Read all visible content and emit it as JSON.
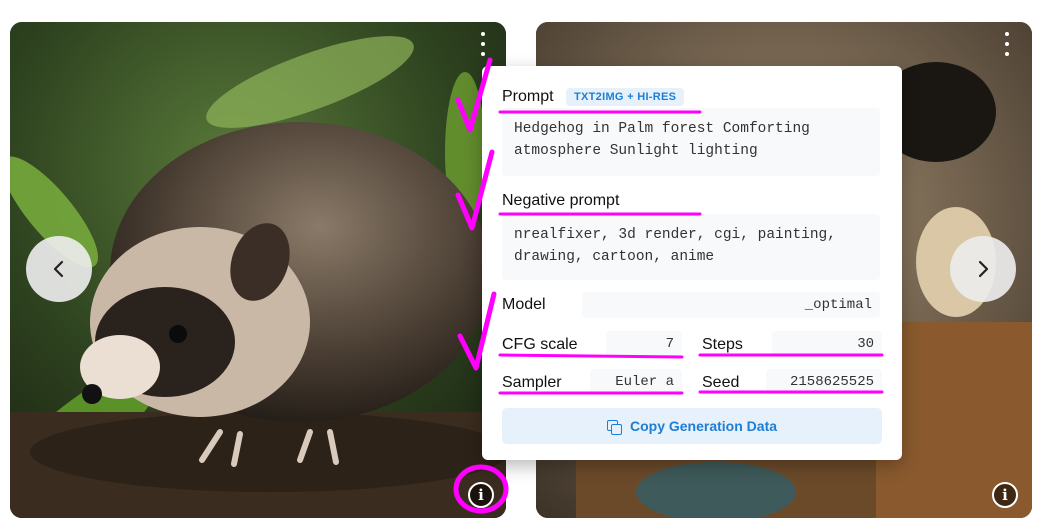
{
  "gallery": {
    "prev_icon": "chevron-left-icon",
    "next_icon": "chevron-right-icon",
    "more_icon": "more-vertical-icon",
    "info_icon": "info-icon",
    "info_glyph": "i"
  },
  "details": {
    "prompt_label": "Prompt",
    "mode_badge": "TXT2IMG + HI-RES",
    "prompt_text": "Hedgehog in Palm forest Comforting atmosphere Sunlight lighting",
    "negative_label": "Negative prompt",
    "negative_text": "nrealfixer, 3d render, cgi, painting, drawing, cartoon, anime",
    "model_label": "Model",
    "model_value": "_optimal",
    "cfg_label": "CFG scale",
    "cfg_value": "7",
    "steps_label": "Steps",
    "steps_value": "30",
    "sampler_label": "Sampler",
    "sampler_value": "Euler a",
    "seed_label": "Seed",
    "seed_value": "2158625525",
    "copy_label": "Copy Generation Data"
  },
  "colors": {
    "accent": "#1c7ed6",
    "accent_bg": "#e7f1fb",
    "annotation": "#ff00ff"
  }
}
